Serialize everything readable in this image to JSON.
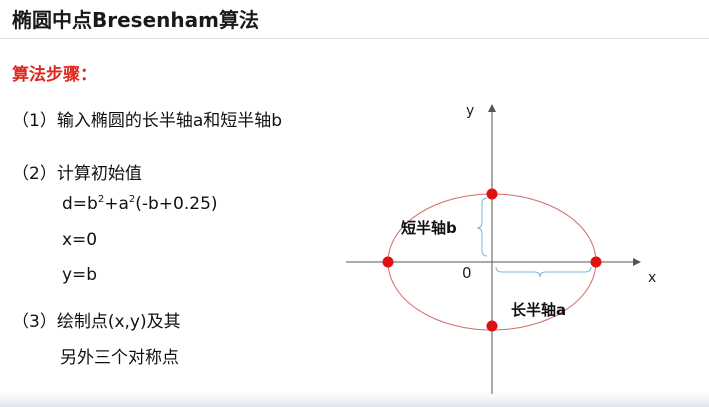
{
  "slide": {
    "title": "椭圆中点Bresenham算法",
    "section_heading": "算法步骤：",
    "steps": {
      "step1": "（1）输入椭圆的长半轴a和短半轴b",
      "step2": "（2）计算初始值",
      "formula": {
        "prefix": "d=b",
        "exp1": "2",
        "mid": "+a",
        "exp2": "2",
        "suffix": "(-b+0.25)"
      },
      "x_init": "x=0",
      "y_init": "y=b",
      "step3_line1": "（3）绘制点(x,y)及其",
      "step3_line2": "另外三个对称点"
    }
  },
  "diagram": {
    "x_axis_label": "x",
    "y_axis_label": "y",
    "origin_label": "0",
    "minor_axis_label": "短半轴b",
    "major_axis_label": "长半轴a",
    "colors": {
      "ellipse": "#d46a6a",
      "points": "#e01010",
      "brace": "#7fb6e0",
      "axes": "#555555"
    }
  }
}
